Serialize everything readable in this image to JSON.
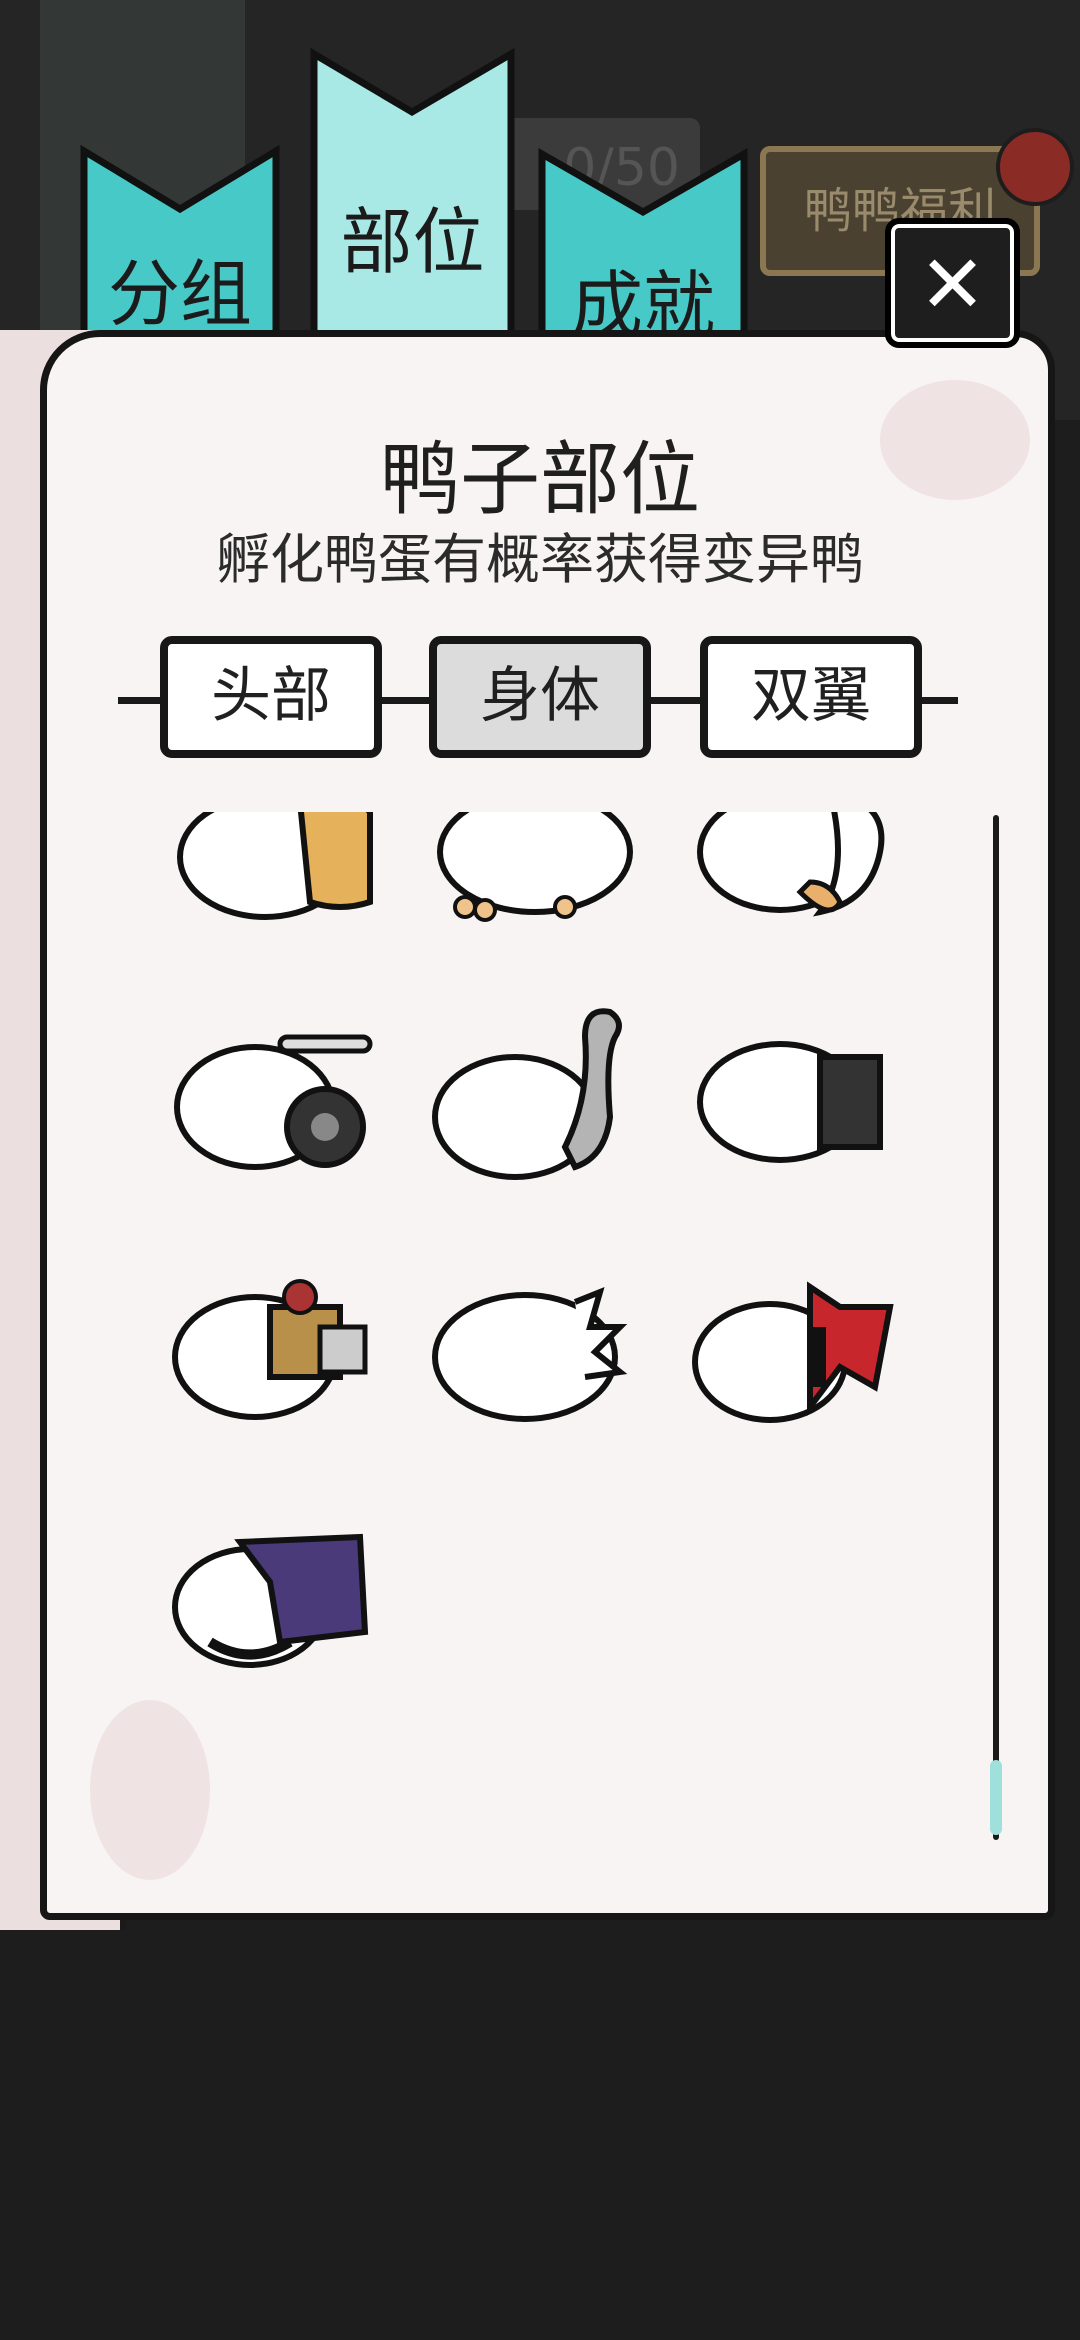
{
  "tabs": [
    {
      "label": "分组"
    },
    {
      "label": "部位"
    },
    {
      "label": "成就"
    }
  ],
  "background": {
    "counter_text": "0/50",
    "welfare_button": "鸭鸭福利"
  },
  "panel": {
    "title": "鸭子部位",
    "subtitle": "孵化鸭蛋有概率获得变异鸭",
    "segments": [
      "头部",
      "身体",
      "双翼"
    ],
    "selected_segment": "身体"
  },
  "parts": [
    {
      "icon": "duck-body-yellow-scarf-icon",
      "accent": "#e5b15a"
    },
    {
      "icon": "duck-body-paws-icon",
      "accent": "#f0c38a"
    },
    {
      "icon": "duck-body-fox-tail-icon",
      "accent": "#e8b06a"
    },
    {
      "icon": "duck-body-wheel-icon",
      "accent": "#333333"
    },
    {
      "icon": "duck-body-long-neck-icon",
      "accent": "#a9a9a9"
    },
    {
      "icon": "duck-body-dark-box-icon",
      "accent": "#333333"
    },
    {
      "icon": "duck-body-mech-gear-icon",
      "accent": "#b8904a"
    },
    {
      "icon": "duck-body-fluffy-icon",
      "accent": "#ffffff"
    },
    {
      "icon": "duck-body-red-bow-icon",
      "accent": "#c8262d"
    },
    {
      "icon": "duck-body-purple-armor-icon",
      "accent": "#4a3a7a"
    }
  ],
  "colors": {
    "tab_teal": "#46c9c7",
    "tab_teal_active": "#a8e9e6",
    "paper": "#f8f4f3",
    "scroll_thumb": "#9fe0dc"
  }
}
